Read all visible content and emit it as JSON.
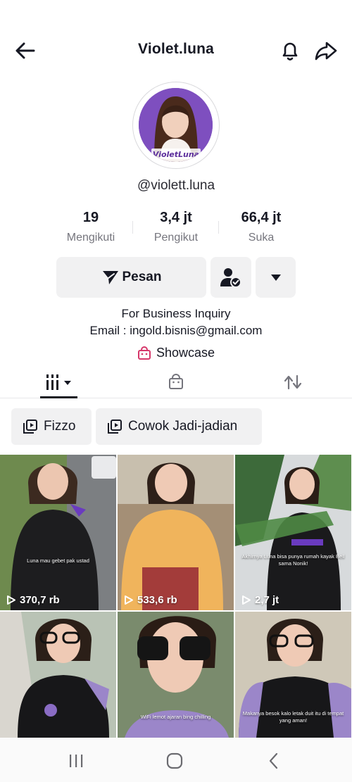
{
  "header": {
    "title": "Violet.luna"
  },
  "profile": {
    "avatar_text": "VioletLuna",
    "username": "@violett.luna",
    "stats": [
      {
        "value": "19",
        "label": "Mengikuti"
      },
      {
        "value": "3,4 jt",
        "label": "Pengikut"
      },
      {
        "value": "66,4 jt",
        "label": "Suka"
      }
    ],
    "message_label": "Pesan",
    "bio_line1": "For Business Inquiry",
    "bio_line2": "Email : ingold.bisnis@gmail.com",
    "showcase_label": "Showcase"
  },
  "playlists": [
    {
      "label": "Fizzo"
    },
    {
      "label": "Cowok Jadi-jadian"
    }
  ],
  "videos": [
    {
      "views": "370,7 rb",
      "caption": "Luna mau gebet pak ustad"
    },
    {
      "views": "533,6 rb",
      "caption": ""
    },
    {
      "views": "2,7 jt",
      "caption": "Akhirnya Luna bisa punya rumah kayak Bell sama Nonik!"
    },
    {
      "views": "",
      "caption": ""
    },
    {
      "views": "",
      "caption": "WiFi lemot ajaran bing chilling"
    },
    {
      "views": "",
      "caption": "Makanya besok kalo letak duit itu di tempat yang aman!"
    }
  ],
  "colors": {
    "accent": "#7e4fbf",
    "text": "#161823",
    "muted": "#75757d",
    "button_bg": "#f1f1f2",
    "showcase": "#d6376a"
  }
}
